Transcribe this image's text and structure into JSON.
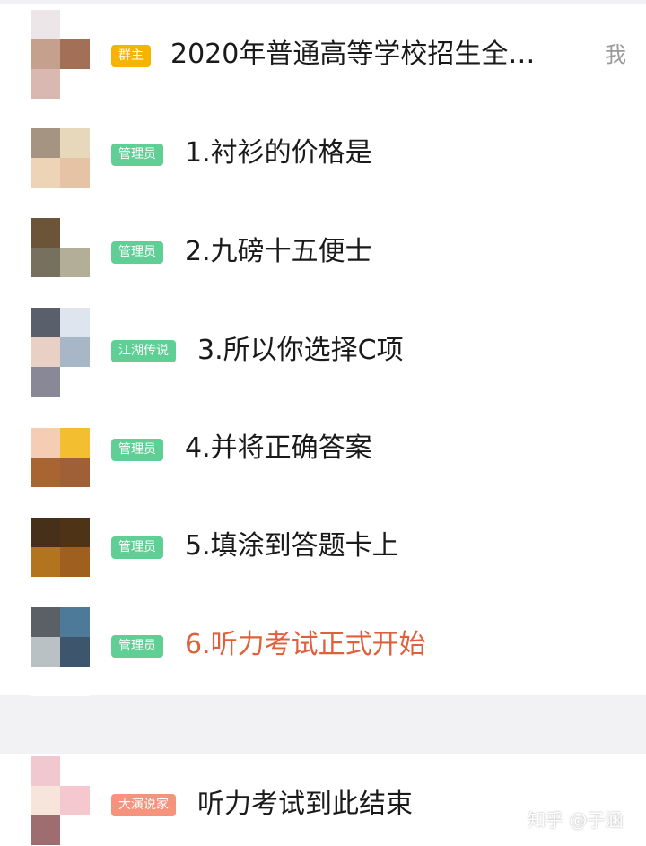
{
  "messages": [
    {
      "badge": "群主",
      "badge_color": "#f4b400",
      "text": "2020年普通高等学校招生全…",
      "text_color": "#1a1a1a",
      "side_label": "我",
      "avatar": [
        "#ece6e8",
        "#ffffff",
        "#c5a08c",
        "#a36f56",
        "#d8b8b0",
        "#ffffff"
      ]
    },
    {
      "badge": "管理员",
      "badge_color": "#5fcf95",
      "text": "1.衬衫的价格是",
      "text_color": "#1a1a1a",
      "avatar": [
        "#a69482",
        "#e7d8bc",
        "#eed4b6",
        "#e7c3a5",
        "#ffffff",
        "#ffffff"
      ]
    },
    {
      "badge": "管理员",
      "badge_color": "#5fcf95",
      "text": "2.九磅十五便士",
      "text_color": "#1a1a1a",
      "avatar": [
        "#6b5438",
        "#ffffff",
        "#77705e",
        "#b2ae97",
        "#ffffff",
        "#ffffff"
      ]
    },
    {
      "badge": "江湖传说",
      "badge_color": "#5fcf95",
      "text": "3.所以你选择C项",
      "text_color": "#1a1a1a",
      "avatar": [
        "#59606b",
        "#dfe5ef",
        "#e9d0c4",
        "#a7b7c7",
        "#888897",
        "#ffffff"
      ]
    },
    {
      "badge": "管理员",
      "badge_color": "#5fcf95",
      "text": "4.并将正确答案",
      "text_color": "#1a1a1a",
      "avatar": [
        "#f5ccb4",
        "#f3bf30",
        "#a86431",
        "#9f6037",
        "#ffffff",
        "#ffffff"
      ]
    },
    {
      "badge": "管理员",
      "badge_color": "#5fcf95",
      "text": "5.填涂到答题卡上",
      "text_color": "#1a1a1a",
      "avatar": [
        "#47301a",
        "#4f3316",
        "#b2741f",
        "#9f5f1f",
        "#ffffff",
        "#ffffff"
      ]
    },
    {
      "badge": "管理员",
      "badge_color": "#5fcf95",
      "text": "6.听力考试正式开始",
      "text_color": "#e0603c",
      "avatar": [
        "#5b5f66",
        "#4c7a98",
        "#bac1c5",
        "#3d566e",
        "#ffffff",
        "#ffffff"
      ]
    },
    {
      "badge": "大演说家",
      "badge_color": "#f5937c",
      "text": "听力考试到此结束",
      "text_color": "#1a1a1a",
      "avatar": [
        "#f1c8cf",
        "#ffffff",
        "#f7e5dc",
        "#f5c8d0",
        "#9d6d70",
        "#ffffff"
      ]
    }
  ],
  "watermark": "知乎 @子涵"
}
